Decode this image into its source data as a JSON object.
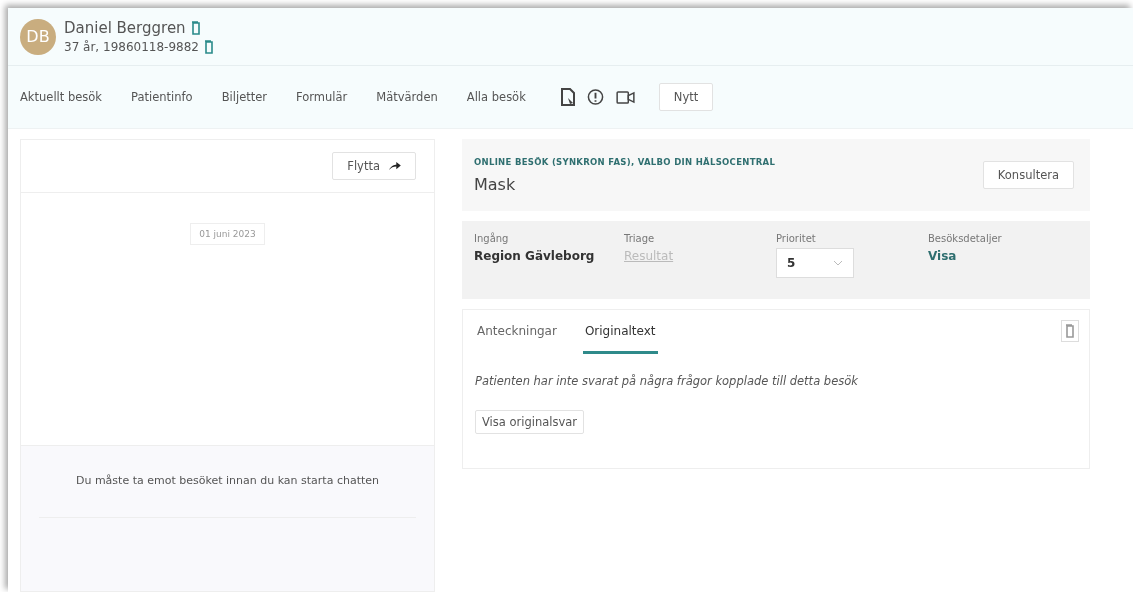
{
  "patient": {
    "initials": "DB",
    "name": "Daniel Berggren",
    "details": "37 år, 19860118-9882"
  },
  "nav": {
    "items": [
      "Aktuellt besök",
      "Patientinfo",
      "Biljetter",
      "Formulär",
      "Mätvärden",
      "Alla besök"
    ],
    "new_button": "Nytt"
  },
  "chat": {
    "move_button": "Flytta",
    "date": "01 juni 2023",
    "notice": "Du måste ta emot besöket innan du kan starta chatten"
  },
  "visit": {
    "category": "ONLINE BESÖK (SYNKRON FAS), VALBO DIN HÄLSOCENTRAL",
    "title": "Mask",
    "consult_button": "Konsultera"
  },
  "details": {
    "fields": [
      {
        "label": "Ingång",
        "kind": "text",
        "value": "Region Gävleborg"
      },
      {
        "label": "Triage",
        "kind": "link",
        "value": "Resultat",
        "disabled": true
      },
      {
        "label": "Prioritet",
        "kind": "select",
        "value": "5"
      },
      {
        "label": "Besöksdetaljer",
        "kind": "link",
        "value": "Visa",
        "disabled": false
      }
    ]
  },
  "notes": {
    "tabs": [
      {
        "label": "Anteckningar",
        "selected": false
      },
      {
        "label": "Originaltext",
        "selected": true
      }
    ],
    "message": "Patienten har inte svarat på några frågor kopplade till detta besök",
    "button": "Visa originalsvar"
  }
}
